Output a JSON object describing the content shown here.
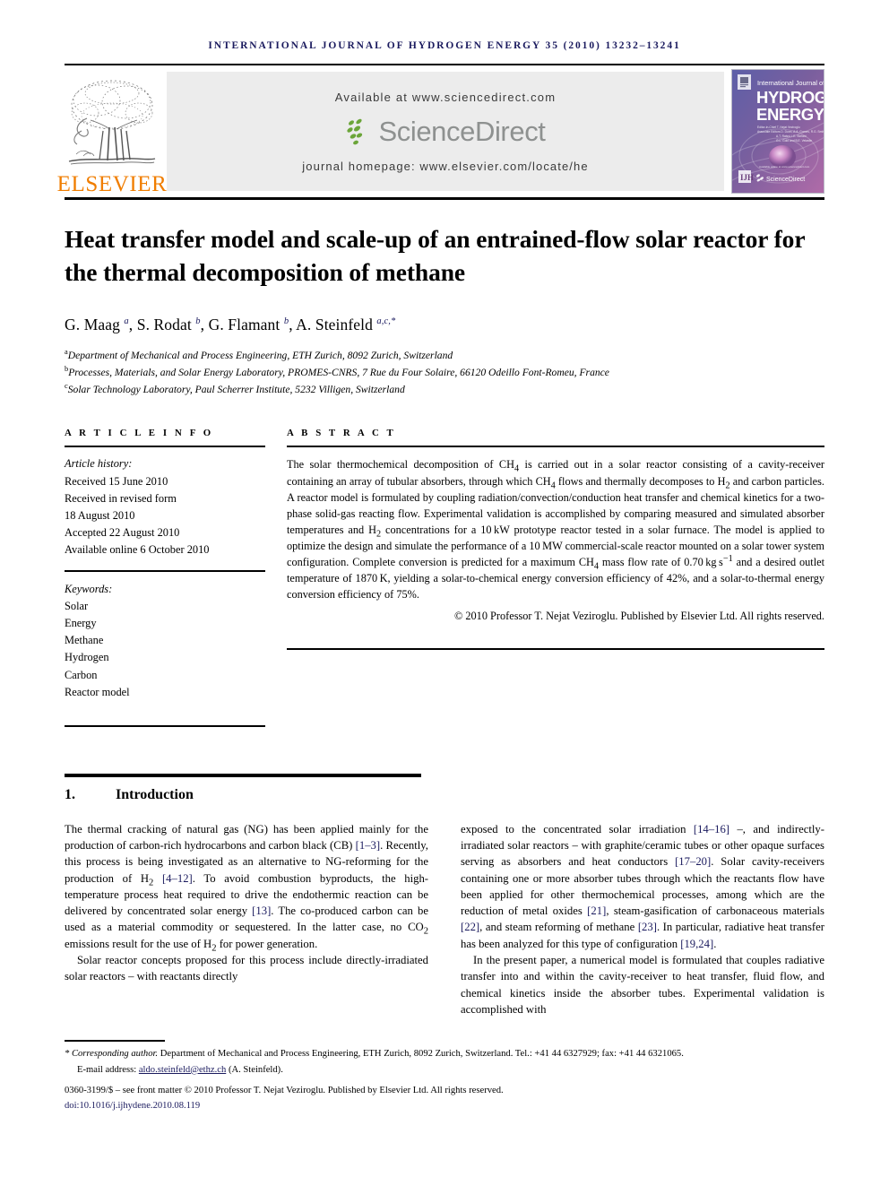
{
  "running_head": "INTERNATIONAL JOURNAL OF HYDROGEN ENERGY 35 (2010) 13232–13241",
  "masthead": {
    "publisher_name": "ELSEVIER",
    "available_at": "Available at www.sciencedirect.com",
    "sciencedirect_word": "ScienceDirect",
    "journal_homepage": "journal homepage: www.elsevier.com/locate/he",
    "cover": {
      "line1": "International Journal of",
      "line2": "HYDROGEN",
      "line3": "ENERGY",
      "editor_block": "Editor-in-Chief  T. Nejat Veziroglu\nAssociate Editors  S. Dunn, A.A. Gomes, R.G. Smith, A.T. Raissi, I.E. Stefani, G.L. Gold and B.E. Velastin",
      "footer_word": "ScienceDirect"
    },
    "accent_orange": "#f07d00",
    "banner_bg": "#ececec"
  },
  "article": {
    "title": "Heat transfer model and scale-up of an entrained-flow solar reactor for the thermal decomposition of methane",
    "authors_html": "G. Maag <sup>a</sup>, S. Rodat <sup>b</sup>, G. Flamant <sup>b</sup>, A. Steinfeld <sup>a,c,*</sup>",
    "affiliations": [
      {
        "marker": "a",
        "text": "Department of Mechanical and Process Engineering, ETH Zurich, 8092 Zurich, Switzerland"
      },
      {
        "marker": "b",
        "text": "Processes, Materials, and Solar Energy Laboratory, PROMES-CNRS, 7 Rue du Four Solaire, 66120 Odeillo Font-Romeu, France"
      },
      {
        "marker": "c",
        "text": "Solar Technology Laboratory, Paul Scherrer Institute, 5232 Villigen, Switzerland"
      }
    ]
  },
  "article_info": {
    "heading": "A R T I C L E   I N F O",
    "history_label": "Article history:",
    "history_lines": [
      "Received 15 June 2010",
      "Received in revised form",
      "18 August 2010",
      "Accepted 22 August 2010",
      "Available online 6 October 2010"
    ],
    "keywords_label": "Keywords:",
    "keywords": [
      "Solar",
      "Energy",
      "Methane",
      "Hydrogen",
      "Carbon",
      "Reactor model"
    ]
  },
  "abstract": {
    "heading": "A B S T R A C T",
    "body_html": "The solar thermochemical decomposition of CH<sub>4</sub> is carried out in a solar reactor consisting of a cavity-receiver containing an array of tubular absorbers, through which CH<sub>4</sub> flows and thermally decomposes to H<sub>2</sub> and carbon particles. A reactor model is formulated by coupling radiation/convection/conduction heat transfer and chemical kinetics for a two-phase solid-gas reacting flow. Experimental validation is accomplished by comparing measured and simulated absorber temperatures and H<sub>2</sub> concentrations for a 10&thinsp;kW prototype reactor tested in a solar furnace. The model is applied to optimize the design and simulate the performance of a 10&thinsp;MW commercial-scale reactor mounted on a solar tower system configuration. Complete conversion is predicted for a maximum CH<sub>4</sub> mass flow rate of 0.70&thinsp;kg&thinsp;s<sup>−1</sup> and a desired outlet temperature of 1870&thinsp;K, yielding a solar-to-chemical energy conversion efficiency of 42%, and a solar-to-thermal energy conversion efficiency of 75%.",
    "copyright": "© 2010 Professor T. Nejat Veziroglu. Published by Elsevier Ltd. All rights reserved."
  },
  "section": {
    "number": "1.",
    "title": "Introduction"
  },
  "body": {
    "left_paragraphs_html": [
      "The thermal cracking of natural gas (NG) has been applied mainly for the production of carbon-rich hydrocarbons and carbon black (CB) <span class=\"ref\">[1–3]</span>. Recently, this process is being investigated as an alternative to NG-reforming for the production of H<sub>2</sub> <span class=\"ref\">[4–12]</span>. To avoid combustion byproducts, the high-temperature process heat required to drive the endothermic reaction can be delivered by concentrated solar energy <span class=\"ref\">[13]</span>. The co-produced carbon can be used as a material commodity or sequestered. In the latter case, no CO<sub>2</sub> emissions result for the use of H<sub>2</sub> for power generation.",
      "Solar reactor concepts proposed for this process include directly-irradiated solar reactors – with reactants directly"
    ],
    "right_paragraphs_html": [
      "exposed to the concentrated solar irradiation <span class=\"ref\">[14–16]</span> –, and indirectly-irradiated solar reactors – with graphite/ceramic tubes or other opaque surfaces serving as absorbers and heat conductors <span class=\"ref\">[17–20]</span>. Solar cavity-receivers containing one or more absorber tubes through which the reactants flow have been applied for other thermochemical processes, among which are the reduction of metal oxides <span class=\"ref\">[21]</span>, steam-gasification of carbonaceous materials <span class=\"ref\">[22]</span>, and steam reforming of methane <span class=\"ref\">[23]</span>. In particular, radiative heat transfer has been analyzed for this type of configuration <span class=\"ref\">[19,24]</span>.",
      "In the present paper, a numerical model is formulated that couples radiative transfer into and within the cavity-receiver to heat transfer, fluid flow, and chemical kinetics inside the absorber tubes. Experimental validation is accomplished with"
    ]
  },
  "footnote": {
    "corresponding_html": "<span class=\"it\">* Corresponding author.</span> Department of Mechanical and Process Engineering, ETH Zurich, 8092 Zurich, Switzerland. Tel.: +41 44 6327929; fax: +41 44 6321065.",
    "email_label": "E-mail address:",
    "email": "aldo.steinfeld@ethz.ch",
    "email_owner": "(A. Steinfeld).",
    "issn_line": "0360-3199/$ – see front matter © 2010 Professor T. Nejat Veziroglu. Published by Elsevier Ltd. All rights reserved.",
    "doi": "doi:10.1016/j.ijhydene.2010.08.119"
  },
  "colors": {
    "navy": "#1a1a5e",
    "elsevier_orange": "#f07d00",
    "sciencedirect_gray": "#8e9190",
    "sciencedirect_green": "#6ba539",
    "banner_gray": "#ececec"
  }
}
